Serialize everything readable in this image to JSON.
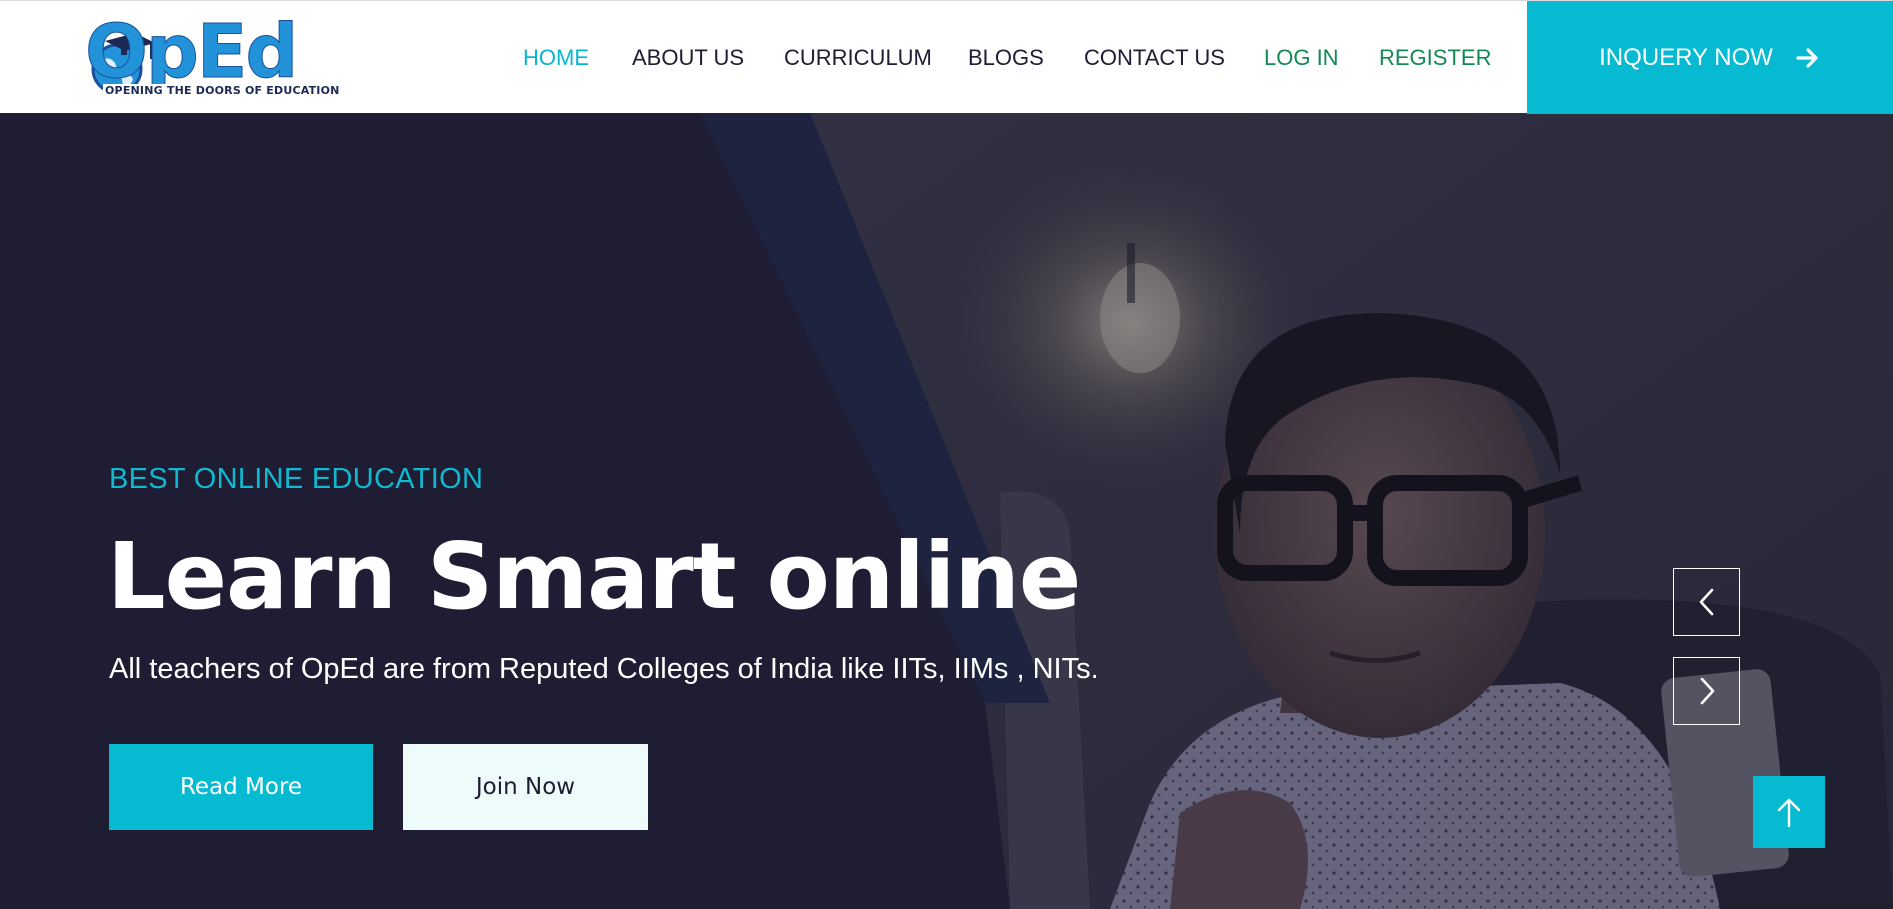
{
  "header": {
    "logo": {
      "wordmark": "OpEd",
      "tagline": "OPENING  THE DOORS OF EDUCATION"
    },
    "nav": [
      {
        "label": "HOME",
        "active": true
      },
      {
        "label": "ABOUT US"
      },
      {
        "label": "CURRICULUM"
      },
      {
        "label": "BLOGS"
      },
      {
        "label": "CONTACT US"
      },
      {
        "label": "LOG IN"
      },
      {
        "label": "REGISTER"
      }
    ],
    "cta": {
      "label": "INQUERY NOW",
      "icon": "arrow-right-icon"
    }
  },
  "hero": {
    "eyebrow": "BEST ONLINE EDUCATION",
    "headline": "Learn Smart online",
    "subtext": "All teachers of OpEd are from Reputed Colleges of India like IITs, IIMs , NITs.",
    "buttons": {
      "read_more": "Read More",
      "join_now": "Join Now"
    },
    "slider": {
      "prev_icon": "chevron-left-icon",
      "next_icon": "chevron-right-icon"
    },
    "back_to_top_icon": "arrow-up-icon"
  },
  "colors": {
    "accent": "#06bbd1",
    "nav_active": "#06b6cf",
    "nav_auth": "#138a54",
    "hero_bg": "#1e1d33",
    "text_dark": "#1e1d33"
  }
}
